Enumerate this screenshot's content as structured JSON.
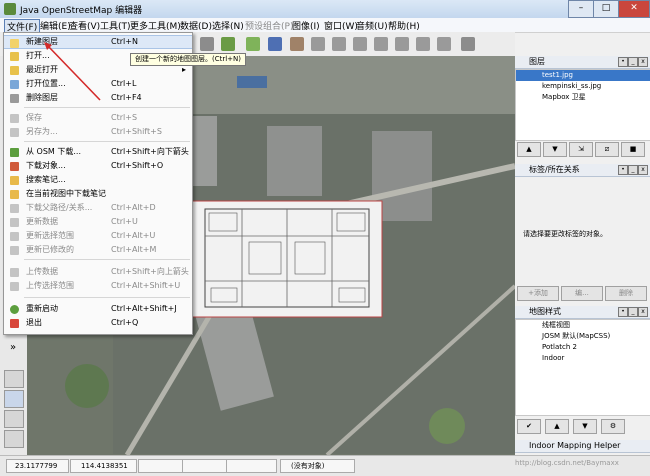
{
  "window": {
    "title": "Java OpenStreetMap 编辑器",
    "minimize": "–",
    "maximize": "□",
    "close": "✕"
  },
  "menubar": {
    "items": [
      "文件(F)",
      "编辑(E)",
      "查看(V)",
      "工具(T)",
      "更多工具(M)",
      "数据(D)",
      "选择(N)",
      "预设组合(P)",
      "图像(I)",
      "窗口(W)",
      "音频(U)",
      "帮助(H)"
    ]
  },
  "file_menu": {
    "items": [
      {
        "label": "新建图层",
        "shortcut": "Ctrl+N",
        "icon": "new-layer-icon"
      },
      {
        "label": "打开...",
        "shortcut": "",
        "icon": "open-icon"
      },
      {
        "label": "最近打开",
        "shortcut": "",
        "icon": "recent-icon"
      },
      {
        "label": "打开位置...",
        "shortcut": "Ctrl+L",
        "icon": "open-location-icon"
      },
      {
        "label": "删除图层",
        "shortcut": "Ctrl+F4",
        "icon": "delete-layer-icon"
      },
      {
        "label": "保存",
        "shortcut": "Ctrl+S",
        "icon": "save-icon"
      },
      {
        "label": "另存为...",
        "shortcut": "Ctrl+Shift+S",
        "icon": "save-as-icon"
      },
      {
        "label": "从 OSM 下载...",
        "shortcut": "Ctrl+Shift+向下箭头",
        "icon": "download-icon"
      },
      {
        "label": "下载对象...",
        "shortcut": "Ctrl+Shift+O",
        "icon": "download-object-icon"
      },
      {
        "label": "搜索笔记...",
        "shortcut": "",
        "icon": "search-notes-icon"
      },
      {
        "label": "在当前视图中下载笔记",
        "shortcut": "",
        "icon": "download-notes-icon"
      },
      {
        "label": "下载父路径/关系...",
        "shortcut": "Ctrl+Alt+D",
        "icon": "download-parent-icon"
      },
      {
        "label": "更新数据",
        "shortcut": "Ctrl+U",
        "icon": "update-data-icon"
      },
      {
        "label": "更新选择范围",
        "shortcut": "Ctrl+Alt+U",
        "icon": "update-selection-icon"
      },
      {
        "label": "更新已修改的",
        "shortcut": "Ctrl+Alt+M",
        "icon": "update-modified-icon"
      },
      {
        "label": "上传数据",
        "shortcut": "Ctrl+Shift+向上箭头",
        "icon": "upload-icon"
      },
      {
        "label": "上传选择范围",
        "shortcut": "Ctrl+Alt+Shift+U",
        "icon": "upload-selection-icon"
      },
      {
        "label": "重新启动",
        "shortcut": "Ctrl+Alt+Shift+J",
        "icon": "restart-icon"
      },
      {
        "label": "退出",
        "shortcut": "Ctrl+Q",
        "icon": "exit-icon"
      }
    ],
    "tooltip": "创建一个新的地图图层。(Ctrl+N)"
  },
  "layers_panel": {
    "title": "图层",
    "layers": [
      "test1.jpg",
      "kempinski_ss.jpg",
      "Mapbox 卫星"
    ]
  },
  "tags_panel": {
    "title": "标签/所在关系",
    "empty_message": "请选择要更改标签的对象。",
    "add_label": "添加",
    "edit_label": "编...",
    "delete_label": "删除"
  },
  "mapstyle_panel": {
    "title": "地图样式",
    "styles": [
      "线框视图",
      "JOSM 默认(MapCSS)",
      "Potlatch 2",
      "Indoor"
    ]
  },
  "indoor_panel": {
    "title": "Indoor Mapping Helper"
  },
  "statusbar": {
    "lat": "23.1177799",
    "lon": "114.4138351",
    "no_object": "(没有对象)"
  },
  "watermark": "http://blog.csdn.net/Baymaxx"
}
